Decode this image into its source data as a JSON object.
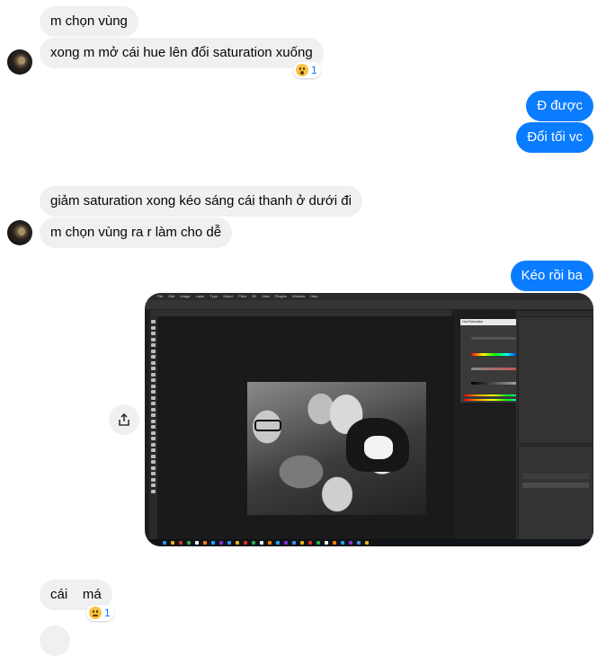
{
  "messages": {
    "m1": "m chọn vùng",
    "m2": "xong m mở cái hue lên đổi saturation xuống",
    "m2_reaction_count": "1",
    "m3": "Đ được",
    "m4": "Đổi tối vc",
    "m5": "giảm saturation xong kéo sáng cái thanh ở dưới đi",
    "m6": "m chọn vùng ra r làm cho dễ",
    "m7": "Kéo rồi ba",
    "m8": "cái    má",
    "m8_reaction_count": "1"
  },
  "reactions": {
    "m2": "surprised-emoji",
    "m8": "sad-emoji"
  },
  "attachment": {
    "type": "screenshot",
    "menu_items": [
      "File",
      "Edit",
      "Image",
      "Layer",
      "Type",
      "Select",
      "Filter",
      "3D",
      "View",
      "Plugins",
      "Window",
      "Help"
    ],
    "dialog_title": "Hue/Saturation"
  },
  "colors": {
    "outgoing_bubble": "#0a7cff",
    "incoming_bubble": "#f0f0f0",
    "reaction_count": "#0a7cff"
  }
}
